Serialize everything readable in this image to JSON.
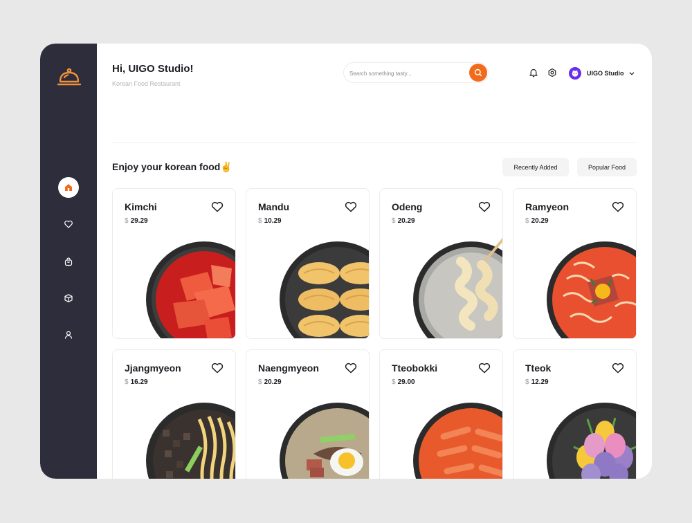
{
  "header": {
    "greeting": "Hi, UIGO Studio!",
    "subtitle": "Korean Food Restaurant",
    "search_placeholder": "Search something tasty...",
    "user_name": "UIGO Studio"
  },
  "sidebar": {
    "logo_icon": "cloche-icon",
    "items": [
      {
        "name": "home",
        "icon": "home-icon",
        "active": true
      },
      {
        "name": "favorites",
        "icon": "heart-icon",
        "active": false
      },
      {
        "name": "orders",
        "icon": "bag-icon",
        "active": false
      },
      {
        "name": "products",
        "icon": "box-icon",
        "active": false
      },
      {
        "name": "profile",
        "icon": "user-icon",
        "active": false
      }
    ]
  },
  "section": {
    "title": "Enjoy your korean food✌️",
    "filters": [
      "Recently Added",
      "Popular Food"
    ]
  },
  "foods": [
    {
      "name": "Kimchi",
      "currency": "$",
      "price": "29.29",
      "dish": "kimchi"
    },
    {
      "name": "Mandu",
      "currency": "$",
      "price": "10.29",
      "dish": "mandu"
    },
    {
      "name": "Odeng",
      "currency": "$",
      "price": "20.29",
      "dish": "odeng"
    },
    {
      "name": "Ramyeon",
      "currency": "$",
      "price": "20.29",
      "dish": "ramyeon"
    },
    {
      "name": "Jjangmyeon",
      "currency": "$",
      "price": "16.29",
      "dish": "jjangmyeon"
    },
    {
      "name": "Naengmyeon",
      "currency": "$",
      "price": "20.29",
      "dish": "naengmyeon"
    },
    {
      "name": "Tteobokki",
      "currency": "$",
      "price": "29.00",
      "dish": "tteobokki"
    },
    {
      "name": "Tteok",
      "currency": "$",
      "price": "12.29",
      "dish": "tteok"
    }
  ],
  "colors": {
    "accent": "#f26a1c",
    "sidebar": "#2e2d3b",
    "avatar": "#6b2ee8"
  }
}
